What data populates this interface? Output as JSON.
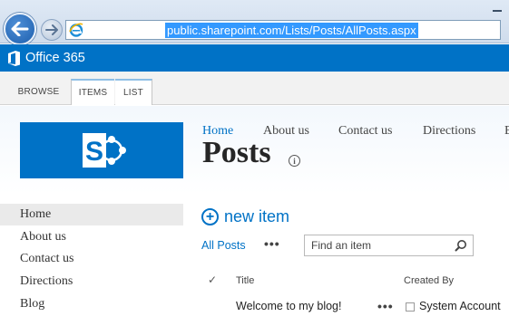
{
  "browser": {
    "url": "public.sharepoint.com/Lists/Posts/AllPosts.aspx"
  },
  "suite_bar": {
    "title": "Office 365"
  },
  "ribbon": {
    "tabs": [
      "BROWSE",
      "ITEMS",
      "LIST"
    ]
  },
  "top_nav": {
    "items": [
      "Home",
      "About us",
      "Contact us",
      "Directions",
      "B"
    ]
  },
  "page": {
    "title": "Posts"
  },
  "left_nav": {
    "items": [
      "Home",
      "About us",
      "Contact us",
      "Directions",
      "Blog"
    ]
  },
  "list": {
    "new_item_label": "new item",
    "view_label": "All Posts",
    "more_label": "•••",
    "search_placeholder": "Find an item",
    "columns": [
      "Title",
      "Created By"
    ],
    "check_header": "✓",
    "rows": [
      {
        "title": "Welcome to my blog!",
        "more": "•••",
        "created_by": "System Account"
      }
    ]
  },
  "colors": {
    "brand_blue": "#0072c6",
    "url_highlight": "#3399ff"
  }
}
